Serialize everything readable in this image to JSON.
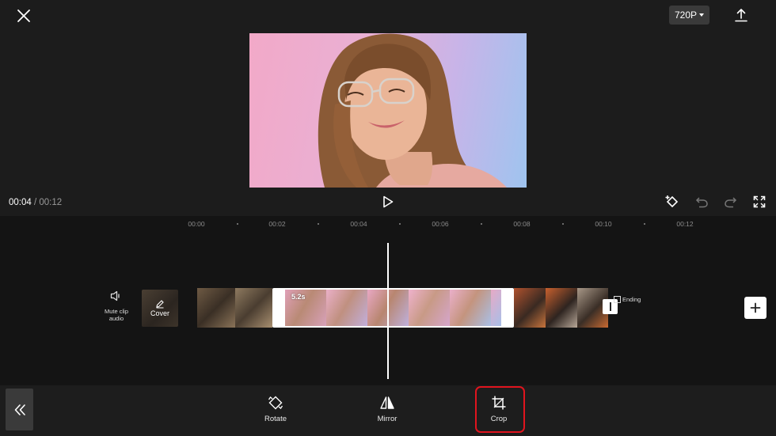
{
  "header": {
    "resolution": "720P"
  },
  "player": {
    "current_time": "00:04",
    "separator": " / ",
    "total_time": "00:12"
  },
  "ruler": {
    "labels": [
      "00:00",
      "00:02",
      "00:04",
      "00:06",
      "00:08",
      "00:10",
      "00:12"
    ]
  },
  "track": {
    "mute_label": "Mute clip audio",
    "cover_label": "Cover",
    "selected_clip_duration": "5.2s",
    "ending_label": "Ending"
  },
  "toolbar": {
    "tools": [
      {
        "label": "Rotate",
        "icon": "rotate-icon"
      },
      {
        "label": "Mirror",
        "icon": "mirror-icon"
      },
      {
        "label": "Crop",
        "icon": "crop-icon"
      }
    ],
    "highlighted_tool": "Crop"
  },
  "colors": {
    "background": "#161616",
    "highlight_box": "#e0141e",
    "button_gray": "#3a3a3a"
  }
}
